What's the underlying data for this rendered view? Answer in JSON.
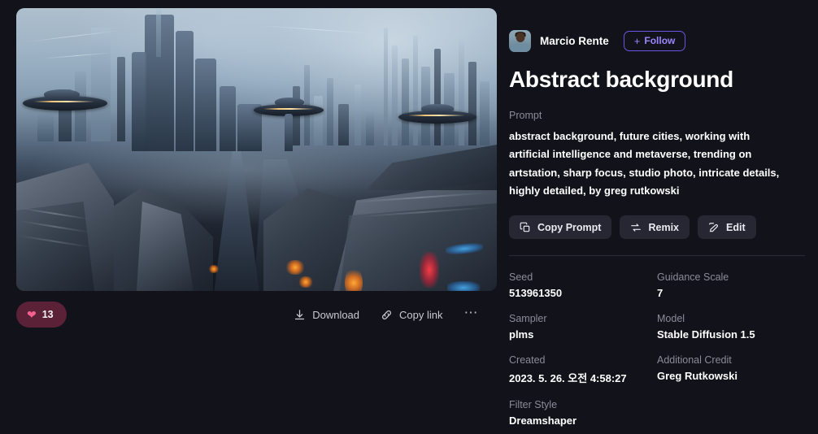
{
  "theme": {
    "page_bg": "#12121a",
    "accent_purple": "#7c5cff",
    "like_pill_bg": "#5a2137",
    "heart_pink": "#f4608f",
    "button_bg": "#272733",
    "label_gray": "#8b8b99"
  },
  "artwork": {
    "alt": "Futuristic sci-fi megacity with towering spires, hazy blue sky, flying saucer ships and a dark foreground structure with orange and red glowing lights",
    "like_count": "13",
    "heart_icon": "heart-icon",
    "download_label": "Download",
    "download_icon": "download-icon",
    "copy_link_label": "Copy link",
    "copy_link_icon": "link-icon",
    "more_label": "⋯",
    "more_icon": "more-horizontal-icon"
  },
  "author": {
    "name": "Marcio Rente",
    "avatar_icon": "user-avatar",
    "follow_label": "Follow",
    "follow_plus": "+"
  },
  "title": "Abstract background",
  "prompt": {
    "label": "Prompt",
    "text": "abstract background, future cities, working with artificial intelligence and metaverse, trending on artstation, sharp focus, studio photo, intricate details, highly detailed, by greg rutkowski"
  },
  "actions": [
    {
      "label": "Copy Prompt",
      "icon": "copy-icon"
    },
    {
      "label": "Remix",
      "icon": "remix-icon"
    },
    {
      "label": "Edit",
      "icon": "edit-pencil-icon"
    }
  ],
  "metadata": [
    {
      "label": "Seed",
      "value": "513961350"
    },
    {
      "label": "Guidance Scale",
      "value": "7"
    },
    {
      "label": "Sampler",
      "value": "plms"
    },
    {
      "label": "Model",
      "value": "Stable Diffusion 1.5"
    },
    {
      "label": "Created",
      "value": "2023. 5. 26. 오전 4:58:27"
    },
    {
      "label": "Additional Credit",
      "value": "Greg Rutkowski"
    },
    {
      "label": "Filter Style",
      "value": "Dreamshaper"
    }
  ]
}
